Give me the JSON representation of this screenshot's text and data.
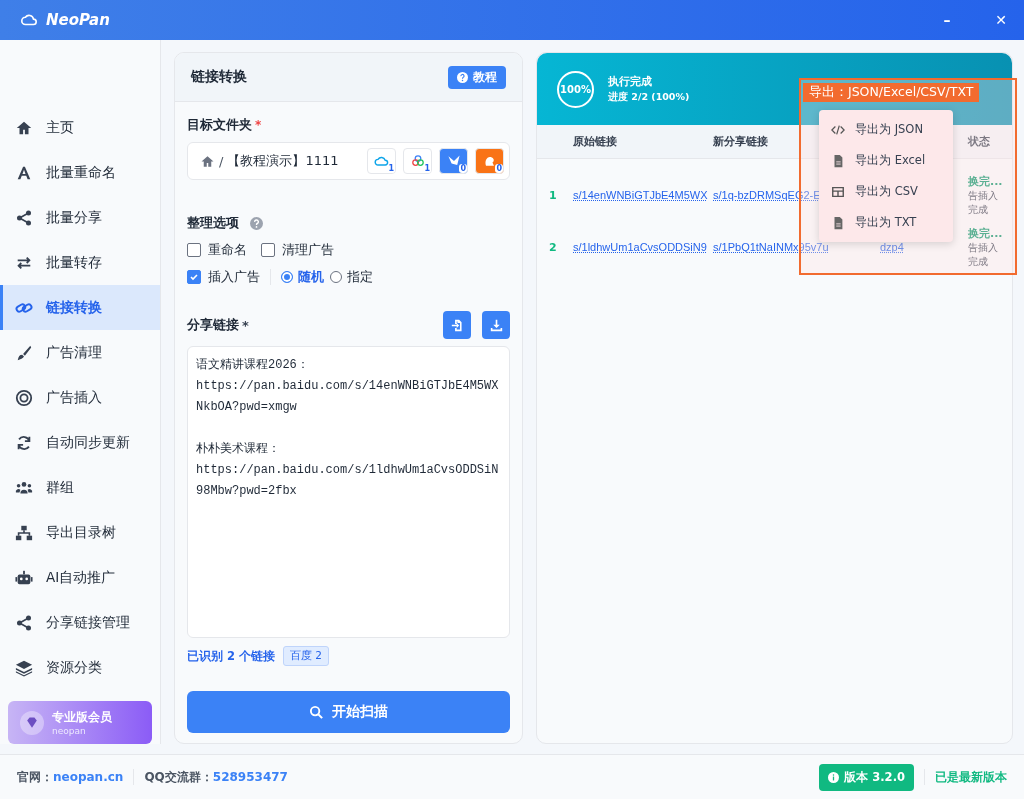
{
  "window": {
    "title": "NeoPan",
    "controls": [
      "–",
      "✕"
    ]
  },
  "sidebar": {
    "items": [
      {
        "label": "主页",
        "selected": false
      },
      {
        "label": "批量重命名",
        "selected": false
      },
      {
        "label": "批量分享",
        "selected": false
      },
      {
        "label": "批量转存",
        "selected": false
      },
      {
        "label": "链接转换",
        "selected": true
      },
      {
        "label": "广告清理",
        "selected": false
      },
      {
        "label": "广告插入",
        "selected": false
      },
      {
        "label": "自动同步更新",
        "selected": false
      },
      {
        "label": "群组",
        "selected": false
      },
      {
        "label": "导出目录树",
        "selected": false
      },
      {
        "label": "AI自动推广",
        "selected": false
      },
      {
        "label": "分享链接管理",
        "selected": false
      },
      {
        "label": "资源分类",
        "selected": false
      }
    ],
    "member": {
      "title": "专业版会员",
      "subtitle": "neopan"
    }
  },
  "left_panel": {
    "title": "链接转换",
    "help_button": "教程",
    "target_folder": {
      "label": "目标文件夹",
      "required": "*",
      "path_sep": "/",
      "path": "【教程演示】1111",
      "accounts": [
        {
          "count": "1"
        },
        {
          "count": "1"
        },
        {
          "count": "0"
        },
        {
          "count": "0"
        }
      ]
    },
    "options": {
      "label": "整理选项",
      "checkboxes": [
        {
          "label": "重命名",
          "checked": false
        },
        {
          "label": "清理广告",
          "checked": false
        }
      ],
      "insert_ad": {
        "label": "插入广告",
        "checked": true
      },
      "radios": [
        {
          "label": "随机",
          "selected": true
        },
        {
          "label": "指定",
          "selected": false
        }
      ]
    },
    "share_links": {
      "label": "分享链接",
      "required": "*",
      "value": "语文精讲课程2026：\nhttps://pan.baidu.com/s/14enWNBiGTJbE4M5WXNkbOA?pwd=xmgw\n\n朴朴美术课程：\nhttps://pan.baidu.com/s/1ldhwUm1aCvsODDSiN98Mbw?pwd=2fbx"
    },
    "recognized": "已识别 2 个链接",
    "tag": "百度 2",
    "start_button": "开始扫描"
  },
  "result_panel": {
    "progress": {
      "percent": "100%",
      "title": "执行完成",
      "detail": "进度 2/2 (100%)"
    },
    "table": {
      "columns": [
        "原始链接",
        "新分享链接",
        "状态"
      ],
      "rows": [
        {
          "index": "1",
          "original": "s/14enWNBiGTJbE4M5WX",
          "new": "s/1q-bzDRMSqEG2-E",
          "status": "换完...",
          "status_detail": "告插入",
          "status_detail_2": "完成"
        },
        {
          "index": "2",
          "original": "s/1ldhwUm1aCvsODDSiN9",
          "new": "s/1PbQ1tNaINMx95v7u",
          "column_4": "dzp4",
          "status": "换完...",
          "status_detail": "告插入",
          "status_detail_2": "完成"
        }
      ]
    },
    "export_menu": [
      "导出为 JSON",
      "导出为 Excel",
      "导出为 CSV",
      "导出为 TXT"
    ],
    "annotation": "导出：JSON/Excel/CSV/TXT"
  },
  "footer": {
    "site_label": "官网：",
    "site": "neopan.cn",
    "qq_label": "QQ交流群：",
    "qq": "528953477",
    "version": "版本 3.2.0",
    "version_status": "已是最新版本"
  }
}
